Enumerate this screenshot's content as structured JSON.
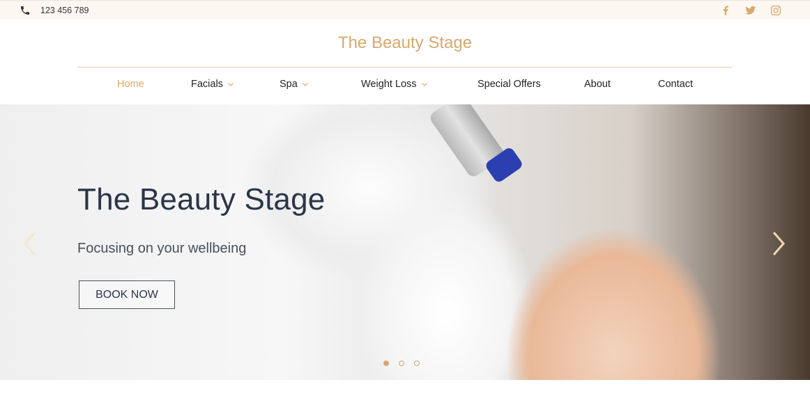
{
  "topbar": {
    "phone_icon": "phone-icon",
    "phone": "123 456 789",
    "social": [
      "facebook-icon",
      "twitter-icon",
      "instagram-icon"
    ]
  },
  "brand": "The Beauty Stage",
  "nav": {
    "items": [
      {
        "label": "Home",
        "active": true,
        "dropdown": false
      },
      {
        "label": "Facials",
        "active": false,
        "dropdown": true
      },
      {
        "label": "Spa",
        "active": false,
        "dropdown": true
      },
      {
        "label": "Weight Loss",
        "active": false,
        "dropdown": true
      },
      {
        "label": "Special Offers",
        "active": false,
        "dropdown": false
      },
      {
        "label": "About",
        "active": false,
        "dropdown": false
      },
      {
        "label": "Contact",
        "active": false,
        "dropdown": false
      }
    ]
  },
  "hero": {
    "title": "The Beauty Stage",
    "subtitle": "Focusing on your wellbeing",
    "cta": "BOOK NOW",
    "slides": 3,
    "active_slide": 1
  },
  "colors": {
    "accent": "#d7a86e",
    "heading": "#2b3548",
    "topbar_bg": "#fdf7f2"
  }
}
